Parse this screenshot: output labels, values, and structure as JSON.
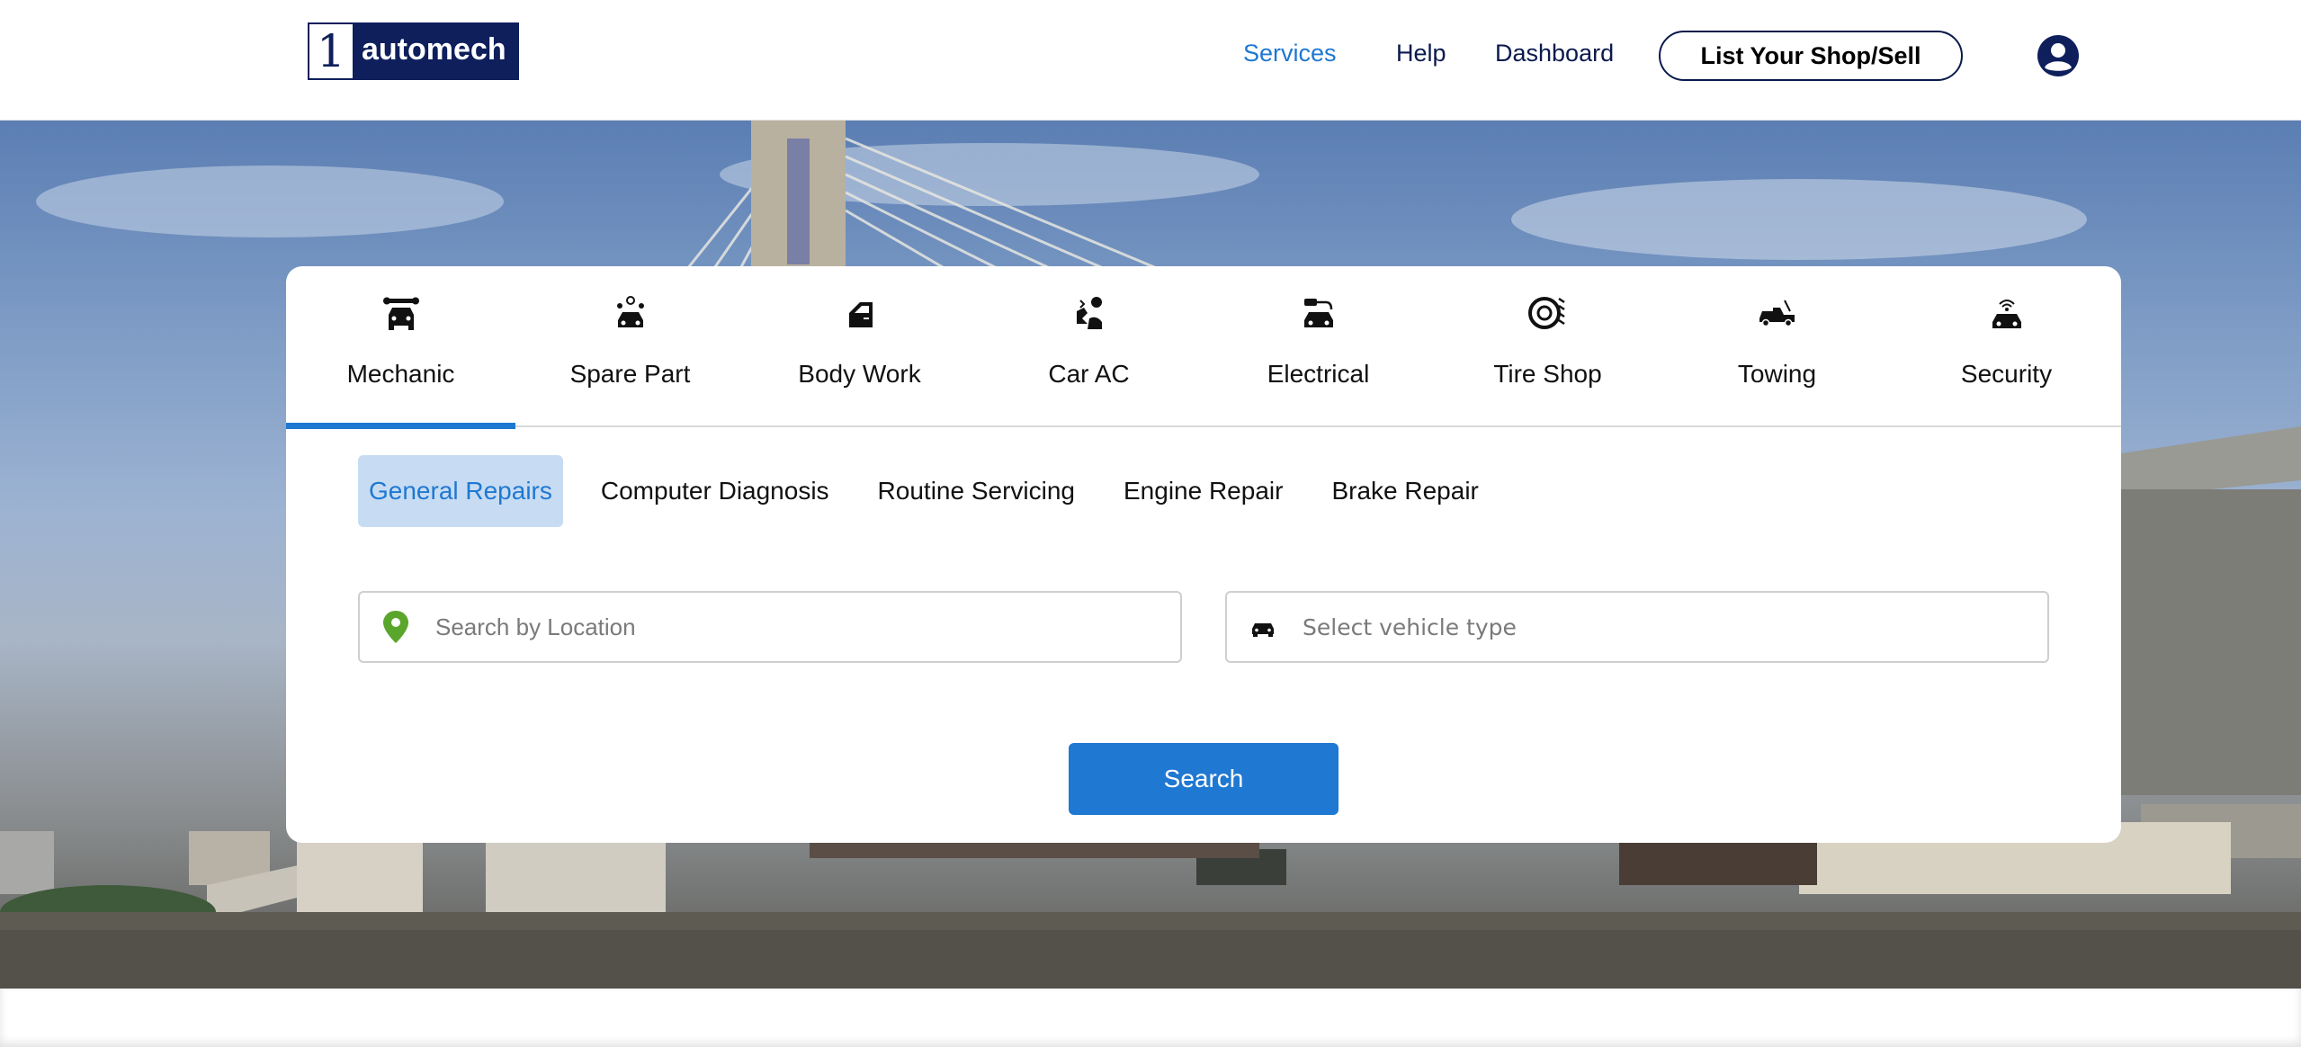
{
  "brand": {
    "logo_number": "1",
    "logo_text": "automech"
  },
  "nav": {
    "links": [
      {
        "label": "Services",
        "active": true
      },
      {
        "label": "Help",
        "active": false
      },
      {
        "label": "Dashboard",
        "active": false
      }
    ],
    "cta_label": "List Your Shop/Sell",
    "profile_icon": "user-circle-icon"
  },
  "categories": [
    {
      "label": "Mechanic",
      "icon": "car-wrench-icon",
      "active": true
    },
    {
      "label": "Spare Part",
      "icon": "car-parts-icon",
      "active": false
    },
    {
      "label": "Body Work",
      "icon": "car-door-icon",
      "active": false
    },
    {
      "label": "Car AC",
      "icon": "car-ac-icon",
      "active": false
    },
    {
      "label": "Electrical",
      "icon": "car-plug-icon",
      "active": false
    },
    {
      "label": "Tire Shop",
      "icon": "tire-icon",
      "active": false
    },
    {
      "label": "Towing",
      "icon": "tow-truck-icon",
      "active": false
    },
    {
      "label": "Security",
      "icon": "car-security-icon",
      "active": false
    }
  ],
  "subcategories": [
    {
      "label": "General Repairs",
      "active": true
    },
    {
      "label": "Computer Diagnosis",
      "active": false
    },
    {
      "label": "Routine Servicing",
      "active": false
    },
    {
      "label": "Engine Repair",
      "active": false
    },
    {
      "label": "Brake Repair",
      "active": false
    }
  ],
  "search": {
    "location_placeholder": "Search by Location",
    "vehicle_placeholder": "Select vehicle type",
    "button_label": "Search"
  },
  "colors": {
    "accent": "#1f78d1",
    "brand_navy": "#0e1f5c",
    "pin_green": "#5aa62c",
    "chip_bg": "#c7dcf2"
  }
}
